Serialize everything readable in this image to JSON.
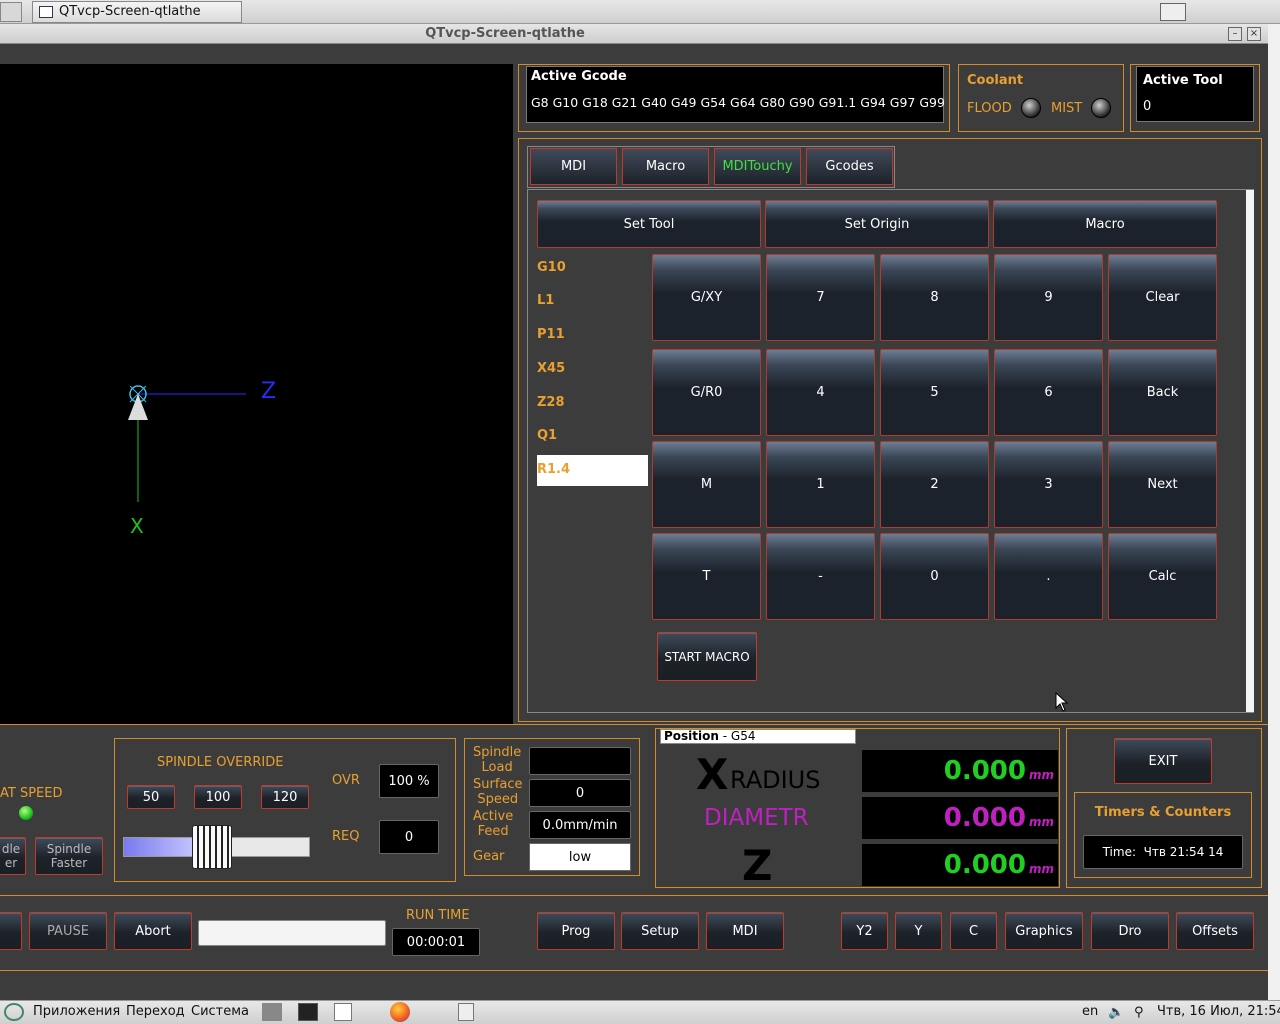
{
  "taskbar_top": {
    "window_title": "QTvcp-Screen-qtlathe"
  },
  "titlebar": {
    "title": "QTvcp-Screen-qtlathe"
  },
  "active_gcode": {
    "label": "Active Gcode",
    "value": "G8 G10 G18 G21 G40 G49 G54 G64 G80 G90 G91.1 G94 G97 G99"
  },
  "coolant": {
    "label": "Coolant",
    "flood": "FLOOD",
    "mist": "MIST"
  },
  "active_tool": {
    "label": "Active Tool",
    "value": "0"
  },
  "tabs": [
    "MDI",
    "Macro",
    "MDITouchy",
    "Gcodes"
  ],
  "active_tab_index": 2,
  "touchy": {
    "mode_buttons": [
      "Set Tool",
      "Set Origin",
      "Macro"
    ],
    "gcode_words": [
      "G10",
      "L1",
      "P11",
      "X45",
      "Z28",
      "Q1"
    ],
    "current_word": "R1.4",
    "keypad": [
      [
        "G/XY",
        "7",
        "8",
        "9",
        "Clear"
      ],
      [
        "G/R0",
        "4",
        "5",
        "6",
        "Back"
      ],
      [
        "M",
        "1",
        "2",
        "3",
        "Next"
      ],
      [
        "T",
        "-",
        "0",
        ".",
        "Calc"
      ]
    ],
    "start_macro": "START MACRO"
  },
  "plot_axes": {
    "z": "Z",
    "x": "X"
  },
  "spindle": {
    "at_speed": "AT SPEED",
    "slower_label": "dle\ner",
    "faster_label": "Spindle\nFaster",
    "override_title": "SPINDLE OVERRIDE",
    "presets": [
      "50",
      "100",
      "120"
    ],
    "ovr_label": "OVR",
    "ovr_value": "100 %",
    "req_label": "REQ",
    "req_value": "0",
    "override_fraction": 0.48
  },
  "spindle_info": {
    "load_label": "Spindle\nLoad",
    "load_value": "",
    "surface_label": "Surface\nSpeed",
    "surface_value": "0",
    "feed_label": "Active\nFeed",
    "feed_value": "0.0mm/min",
    "gear_label": "Gear",
    "gear_value": "low"
  },
  "position": {
    "title": "Position",
    "system": "- G54",
    "axes": [
      {
        "letter": "X",
        "name": "RADIUS",
        "value": "0.000",
        "unit": "mm"
      },
      {
        "letter": "",
        "name": "DIAMETR",
        "value": "0.000",
        "unit": "mm"
      },
      {
        "letter": "Z",
        "name": "",
        "value": "0.000",
        "unit": "mm"
      }
    ]
  },
  "exit_label": "EXIT",
  "timers": {
    "title": "Timers & Counters",
    "time_label": "Time:",
    "time_value": "Чтв 21:54 14"
  },
  "run": {
    "pause": "PAUSE",
    "abort": "Abort",
    "run_time_label": "RUN TIME",
    "run_time_value": "00:00:01"
  },
  "bottom_buttons_left": [
    "Prog",
    "Setup",
    "MDI"
  ],
  "bottom_buttons_right": [
    "Y2",
    "Y",
    "C",
    "Graphics",
    "Dro",
    "Offsets"
  ],
  "taskbar_bottom": {
    "apps": "Приложения",
    "go": "Переход",
    "system": "Система",
    "lang": "en",
    "clock": "Чтв, 16 Июл, 21:54"
  },
  "colors": {
    "accent_orange": "#e8a030",
    "dro_green": "#20d020",
    "dro_magenta": "#c020c0",
    "border_red": "#c0392b"
  }
}
